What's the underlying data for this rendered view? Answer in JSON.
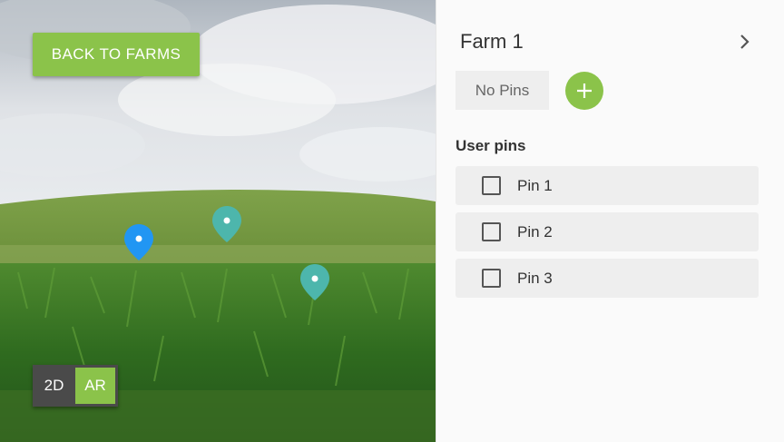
{
  "scene": {
    "back_button_label": "BACK TO FARMS",
    "pins": [
      {
        "name": "blue",
        "color": "#2196f3"
      },
      {
        "name": "teal",
        "color": "#4db6ac"
      },
      {
        "name": "teal",
        "color": "#4db6ac"
      }
    ],
    "mode_toggle": {
      "options": [
        "2D",
        "AR"
      ],
      "selected": "AR"
    },
    "colors": {
      "accent": "#8bc34a",
      "dark": "#4a4a4a"
    }
  },
  "panel": {
    "farm_title": "Farm 1",
    "chevron_icon": "chevron-right-icon",
    "no_pins_label": "No Pins",
    "add_icon": "plus-icon",
    "section_label": "User pins",
    "pins": [
      {
        "label": "Pin 1",
        "checked": false
      },
      {
        "label": "Pin 2",
        "checked": false
      },
      {
        "label": "Pin 3",
        "checked": false
      }
    ]
  }
}
